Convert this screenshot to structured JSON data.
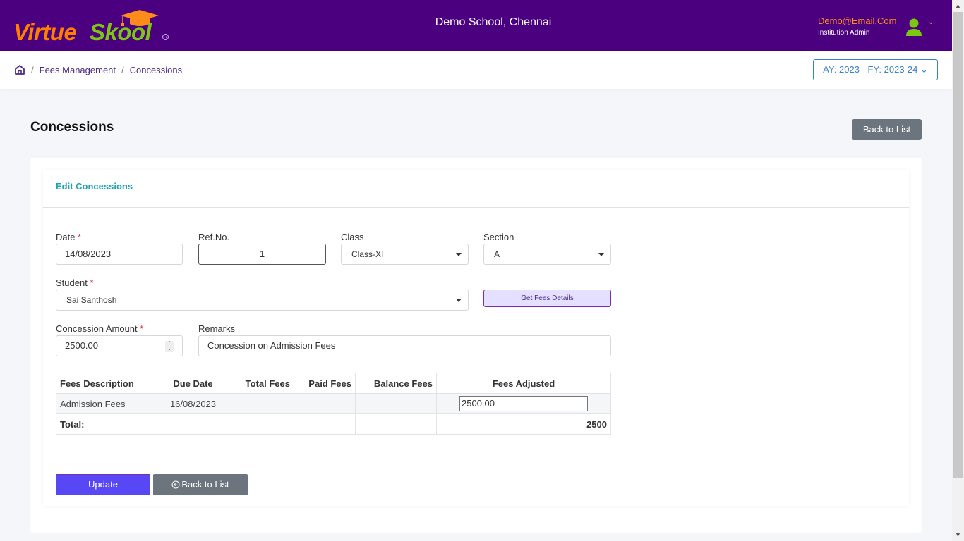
{
  "header": {
    "logo_part1": "Virtue",
    "logo_part2": "Skool",
    "logo_reg": "R",
    "school_name": "Demo School, Chennai",
    "user_email": "Demo@Email.Com",
    "user_role": "Institution Admin",
    "user_menu_chevron": "⌄"
  },
  "breadcrumb": {
    "home_icon": "home-icon",
    "separator": "/",
    "items": [
      "Fees Management",
      "Concessions"
    ]
  },
  "academic_year": "AY: 2023 - FY: 2023-24 ⌄",
  "page": {
    "title": "Concessions",
    "back_to_list_label": "Back to List"
  },
  "form": {
    "card_title": "Edit Concessions",
    "required_mark": "*",
    "date": {
      "label": "Date",
      "value": "14/08/2023"
    },
    "ref_no": {
      "label": "Ref.No.",
      "value": "1"
    },
    "class": {
      "label": "Class",
      "value": "Class-XI"
    },
    "section": {
      "label": "Section",
      "value": "A"
    },
    "student": {
      "label": "Student",
      "value": "Sai Santhosh"
    },
    "get_fees_label": "Get Fees Details",
    "concession_amount": {
      "label": "Concession Amount",
      "value": "2500.00"
    },
    "remarks": {
      "label": "Remarks",
      "value": "Concession on Admission Fees"
    }
  },
  "fees_table": {
    "headers": [
      "Fees Description",
      "Due Date",
      "Total Fees",
      "Paid Fees",
      "Balance Fees",
      "Fees Adjusted"
    ],
    "rows": [
      {
        "description": "Admission Fees",
        "due_date": "16/08/2023",
        "total_fees": "",
        "paid_fees": "",
        "balance_fees": "",
        "fees_adjusted": "2500.00"
      }
    ],
    "total_label": "Total:",
    "total_adjusted": "2500"
  },
  "actions": {
    "update_label": "Update",
    "back_label": "Back to List"
  },
  "colors": {
    "header_bg": "#4b0080",
    "accent_orange": "#ff7f00",
    "accent_green": "#7cc70f",
    "update_btn": "#5847f5",
    "secondary_btn": "#6c757d",
    "card_title": "#1ea3b3"
  }
}
